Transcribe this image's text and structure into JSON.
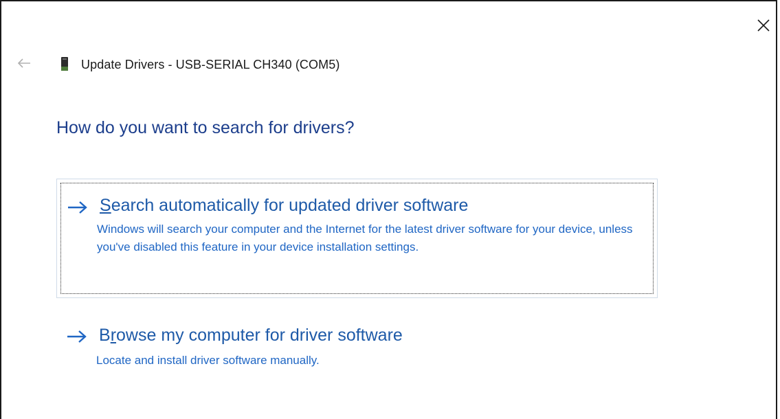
{
  "window": {
    "title": "Update Drivers - USB-SERIAL CH340 (COM5)",
    "close_icon": "close-icon",
    "back_icon": "back-arrow-icon",
    "device_icon": "usb-device-icon"
  },
  "heading": "How do you want to search for drivers?",
  "options": [
    {
      "title_prefix": "",
      "title_access_key": "S",
      "title_rest": "earch automatically for updated driver software",
      "description": "Windows will search your computer and the Internet for the latest driver software for your device, unless you've disabled this feature in your device installation settings.",
      "focused": true
    },
    {
      "title_prefix": "B",
      "title_access_key": "r",
      "title_rest": "owse my computer for driver software",
      "description": "Locate and install driver software manually.",
      "focused": false
    }
  ],
  "colors": {
    "heading": "#1c3e8c",
    "option_title": "#1e5aa8",
    "option_desc": "#1f66c4",
    "arrow": "#1f66c4"
  }
}
